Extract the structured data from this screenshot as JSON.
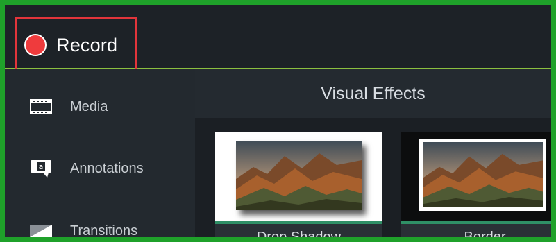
{
  "header": {
    "record_label": "Record"
  },
  "sidebar": {
    "items": [
      {
        "label": "Media",
        "icon": "film-icon"
      },
      {
        "label": "Annotations",
        "icon": "annotation-icon"
      },
      {
        "label": "Transitions",
        "icon": "transition-icon"
      }
    ]
  },
  "panel": {
    "title": "Visual Effects",
    "effects": [
      {
        "label": "Drop Shadow"
      },
      {
        "label": "Border"
      }
    ]
  },
  "colors": {
    "outer_border": "#1fa12a",
    "record_highlight": "#e2353b",
    "record_dot": "#ef3b3d",
    "accent_line": "#8bbf3f",
    "card_accent": "#2f8f66"
  }
}
